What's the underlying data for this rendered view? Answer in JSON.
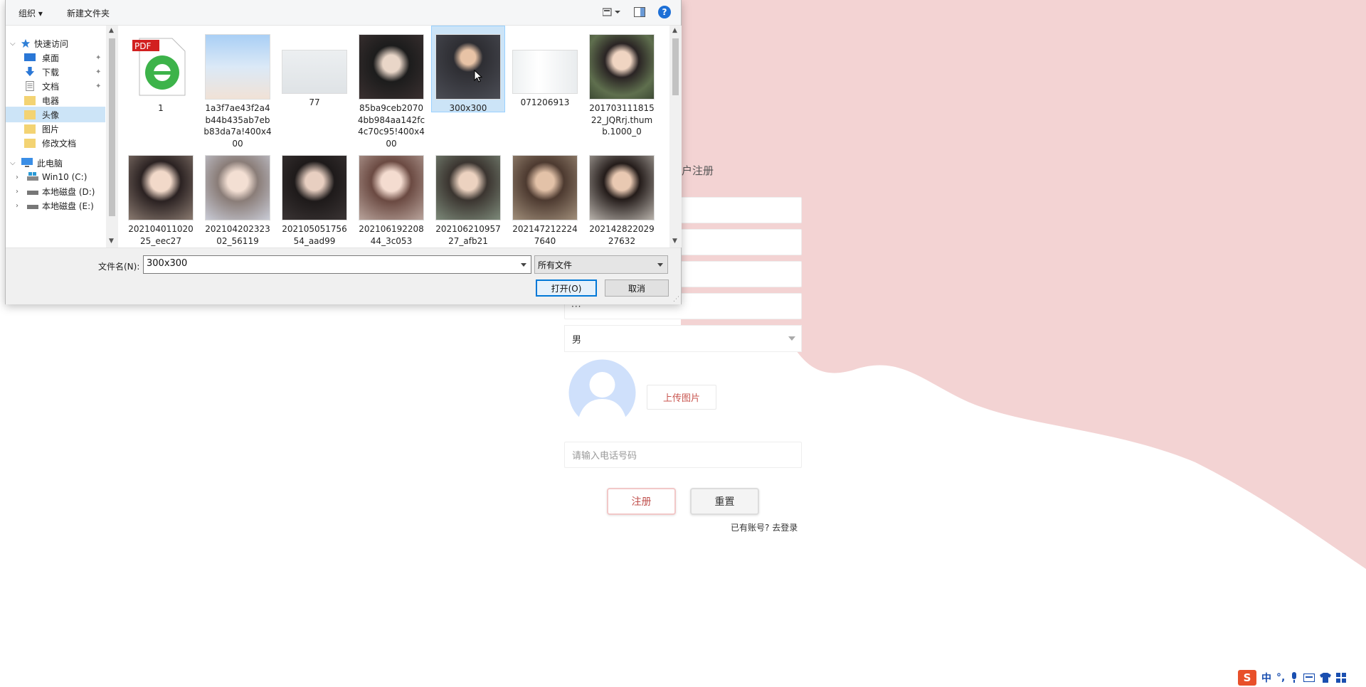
{
  "page": {
    "title_fragment": "户注册",
    "dots": "···",
    "gender_selected": "男",
    "upload_label": "上传图片",
    "phone_placeholder": "请输入电话号码",
    "register_label": "注册",
    "reset_label": "重置",
    "login_prompt": "已有账号?",
    "login_link": "去登录",
    "colors": {
      "wave": "#f3d3d3",
      "accent": "#c0504d",
      "avatar": "#cfe0fb"
    }
  },
  "dialog": {
    "toolbar": {
      "organize_label": "组织 ▾",
      "new_folder_label": "新建文件夹"
    },
    "nav": {
      "items": [
        {
          "label": "快速访问",
          "icon": "star-icon",
          "group": true,
          "expanded": true
        },
        {
          "label": "桌面",
          "icon": "desktop-icon",
          "pinned": true
        },
        {
          "label": "下载",
          "icon": "download-icon",
          "pinned": true
        },
        {
          "label": "文档",
          "icon": "document-icon",
          "pinned": true
        },
        {
          "label": "电器",
          "icon": "folder-icon"
        },
        {
          "label": "头像",
          "icon": "folder-icon",
          "selected": true
        },
        {
          "label": "图片",
          "icon": "folder-icon"
        },
        {
          "label": "修改文档",
          "icon": "folder-icon"
        },
        {
          "label": "此电脑",
          "icon": "computer-icon",
          "group": true,
          "expanded": true
        },
        {
          "label": "Win10 (C:)",
          "icon": "drive-icon"
        },
        {
          "label": "本地磁盘 (D:)",
          "icon": "drive-icon"
        },
        {
          "label": "本地磁盘 (E:)",
          "icon": "drive-icon"
        }
      ]
    },
    "files": [
      {
        "name": "1",
        "kind": "pdf"
      },
      {
        "name": "1a3f7ae43f2a4b44b435ab7ebb83da7a!400x400",
        "kind": "photo"
      },
      {
        "name": "77",
        "kind": "photo"
      },
      {
        "name": "85ba9ceb20704bb984aa142fc4c70c95!400x400",
        "kind": "photo"
      },
      {
        "name": "300x300",
        "kind": "photo",
        "selected": true
      },
      {
        "name": "071206913",
        "kind": "photo"
      },
      {
        "name": "20170311181522_JQRrj.thumb.1000_0",
        "kind": "photo"
      },
      {
        "name": "20210401102025_eec27",
        "kind": "photo"
      },
      {
        "name": "20210420232302_56119",
        "kind": "photo"
      },
      {
        "name": "20210505175654_aad99",
        "kind": "photo"
      },
      {
        "name": "20210619220844_3c053",
        "kind": "photo"
      },
      {
        "name": "20210621095727_afb21",
        "kind": "photo"
      },
      {
        "name": "2021472122247640",
        "kind": "photo"
      },
      {
        "name": "20214282202927632",
        "kind": "photo"
      }
    ],
    "pdf_badge": "PDF",
    "filename_label": "文件名(N):",
    "filename_value": "300x300",
    "filetype_value": "所有文件",
    "open_label": "打开(O)",
    "cancel_label": "取消"
  },
  "ime": {
    "mode": "中",
    "punct": "°,",
    "logo": "S"
  }
}
